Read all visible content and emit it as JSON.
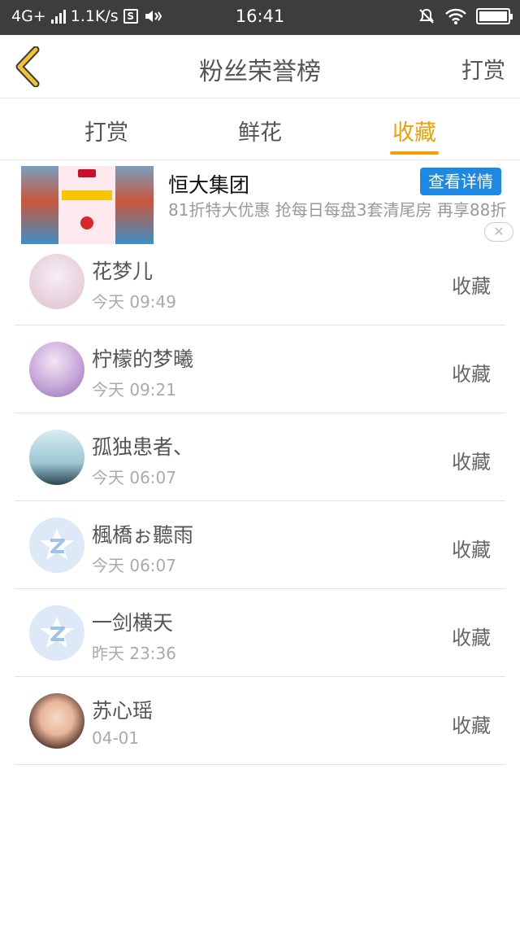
{
  "status_bar": {
    "network": "4G+",
    "speed": "1.1K/s",
    "time": "16:41",
    "battery_level": 1.0
  },
  "header": {
    "title": "粉丝荣誉榜",
    "right_button": "打赏"
  },
  "tabs": [
    {
      "label": "打赏",
      "active": false
    },
    {
      "label": "鲜花",
      "active": false
    },
    {
      "label": "收藏",
      "active": true
    }
  ],
  "ad": {
    "title": "恒大集团",
    "button": "查看详情",
    "description": "81折特大优惠 抢每日每盘3套清尾房 再享88折"
  },
  "list": [
    {
      "name": "花梦儿",
      "time": "今天 09:49",
      "action": "收藏",
      "avatar": "anime-girl-avatar"
    },
    {
      "name": "柠檬的梦曦",
      "time": "今天 09:21",
      "action": "收藏",
      "avatar": "anime-girl-avatar"
    },
    {
      "name": "孤独患者、",
      "time": "今天 06:07",
      "action": "收藏",
      "avatar": "photo-avatar"
    },
    {
      "name": "楓橋ぉ聽雨",
      "time": "今天 06:07",
      "action": "收藏",
      "avatar": "default-avatar"
    },
    {
      "name": "一剑横天",
      "time": "昨天 23:36",
      "action": "收藏",
      "avatar": "default-avatar"
    },
    {
      "name": "苏心瑶",
      "time": "04-01",
      "action": "收藏",
      "avatar": "child-photo-avatar"
    }
  ],
  "colors": {
    "accent": "#f29f05",
    "ad_button": "#1e88e5",
    "status_bar": "#3d3d3d"
  }
}
